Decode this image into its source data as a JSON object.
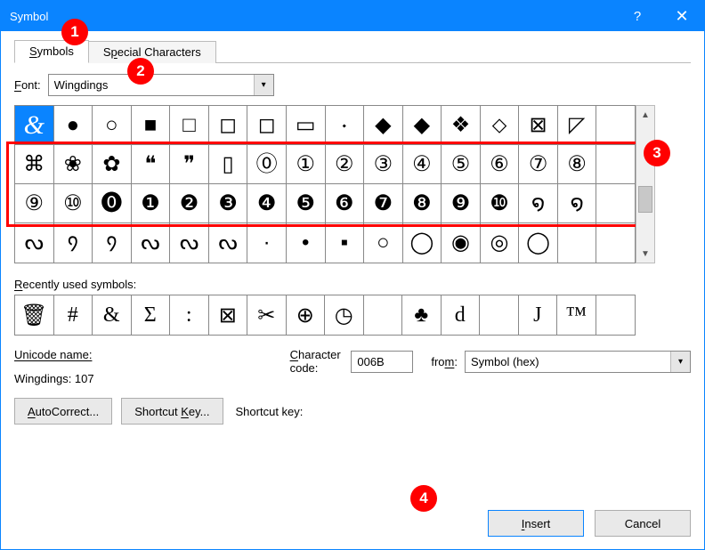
{
  "window": {
    "title": "Symbol"
  },
  "tabs": {
    "symbols": "Symbols",
    "special": "Special Characters",
    "symbols_u": "S",
    "special_u": "S"
  },
  "font": {
    "label": "Font:",
    "label_u": "F",
    "value": "Wingdings"
  },
  "grid": {
    "rows": [
      [
        "&",
        "●",
        "○",
        "■",
        "□",
        "◻",
        "◻",
        "▭",
        "🞗",
        "◆",
        "◆",
        "❖",
        "⬦",
        "⊠",
        "◸"
      ],
      [
        "⌘",
        "❀",
        "✿",
        "❝",
        "❞",
        "▯",
        "⓪",
        "①",
        "②",
        "③",
        "④",
        "⑤",
        "⑥",
        "⑦",
        "⑧"
      ],
      [
        "⑨",
        "⑩",
        "⓿",
        "❶",
        "❷",
        "❸",
        "❹",
        "❺",
        "❻",
        "❼",
        "❽",
        "❾",
        "❿",
        "໑",
        "໑"
      ],
      [
        "ᔓ",
        "᠀",
        "᠀",
        "ᔓ",
        "ᔓ",
        "ᔓ",
        "·",
        "•",
        "▪",
        "○",
        "◯",
        "◉",
        "◎",
        "◯",
        ""
      ]
    ],
    "selected": [
      0,
      0
    ]
  },
  "recent": {
    "label": "Recently used symbols:",
    "items": [
      "🗑",
      "#",
      "&",
      "Σ",
      ":",
      "⊠",
      "✂",
      "⊕",
      "◷",
      "",
      "♣",
      "d",
      "",
      "J",
      "™",
      ""
    ]
  },
  "unicode": {
    "name_label": "Unicode name:",
    "name_value": "Wingdings: 107",
    "code_label": "Character code:",
    "code_label_u": "C",
    "code_value": "006B",
    "from_label": "from:",
    "from_label_u": "m",
    "from_value": "Symbol (hex)"
  },
  "buttons": {
    "autocorrect": "AutoCorrect...",
    "autocorrect_u": "A",
    "shortcut": "Shortcut Key...",
    "shortcut_u": "K",
    "shortcut_label": "Shortcut key:",
    "insert": "Insert",
    "insert_u": "I",
    "cancel": "Cancel"
  },
  "callouts": {
    "c1": "1",
    "c2": "2",
    "c3": "3",
    "c4": "4"
  }
}
